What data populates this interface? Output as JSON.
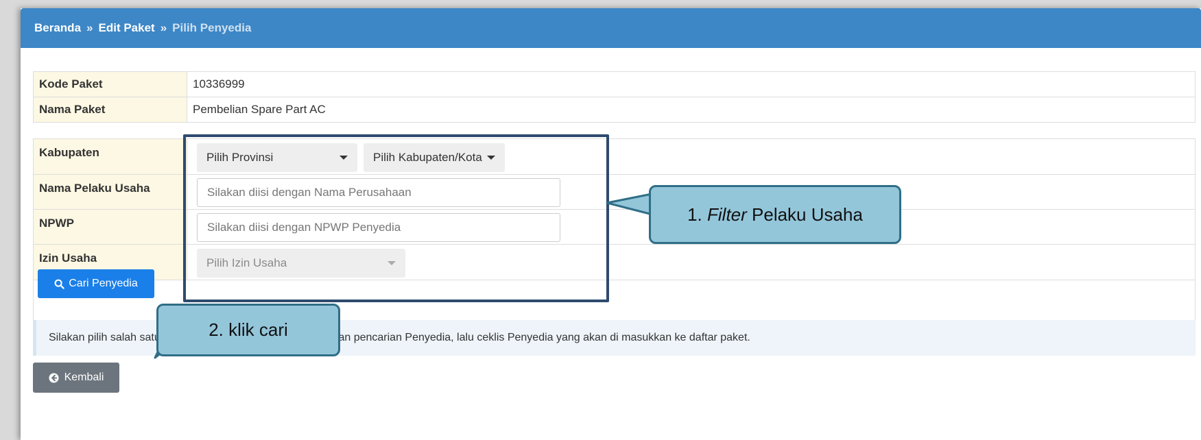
{
  "breadcrumb": {
    "home": "Beranda",
    "sep1": "»",
    "edit": "Edit Paket",
    "sep2": "»",
    "current": "Pilih Penyedia"
  },
  "info": {
    "kode_label": "Kode Paket",
    "kode_value": "10336999",
    "nama_label": "Nama Paket",
    "nama_value": "Pembelian Spare Part AC"
  },
  "filter": {
    "kabupaten_label": "Kabupaten",
    "provinsi_select": "Pilih Provinsi",
    "kabkota_select": "Pilih Kabupaten/Kota",
    "nama_label": "Nama Pelaku Usaha",
    "nama_placeholder": "Silakan diisi dengan Nama Perusahaan",
    "npwp_label": "NPWP",
    "npwp_placeholder": "Silakan diisi dengan NPWP Penyedia",
    "izin_label": "Izin Usaha",
    "izin_select": "Pilih Izin Usaha"
  },
  "buttons": {
    "cari": "Cari Penyedia",
    "kembali": "Kembali"
  },
  "alert_text": "Silakan pilih salah satu paramater pencarian untuk melakukan pencarian Penyedia, lalu ceklis Penyedia yang akan di masukkan ke daftar paket.",
  "callouts": {
    "one_prefix": "1. ",
    "one_italic": "Filter",
    "one_suffix": " Pelaku Usaha",
    "two": "2. klik cari"
  },
  "icons": {
    "search": "search-icon",
    "back": "arrow-circle-left-icon",
    "dropdown": "caret-down-icon"
  },
  "colors": {
    "header": "#3d87c7",
    "primary_button": "#1a7fe8",
    "secondary_button": "#6c757d",
    "label_bg": "#fcf8e3",
    "callout_fill": "#94c6da",
    "callout_border": "#2f6e86",
    "highlight_border": "#2e4a6e"
  }
}
